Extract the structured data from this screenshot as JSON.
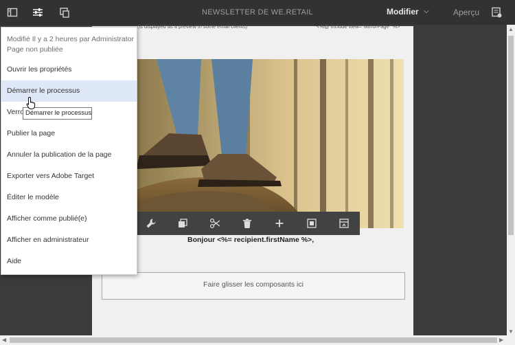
{
  "header": {
    "title": "NEWSLETTER DE WE.RETAIL",
    "mode": "Modifier",
    "preview": "Aperçu"
  },
  "canvas": {
    "preview_text": "(is displayed as a preview in some email clients)",
    "mirror_text": "<%@ include view=\"MirrorPage\" %>",
    "greeting_prefix": "Bonjour ",
    "greeting_var": "<%= recipient.firstName %>",
    "greeting_suffix": ",",
    "dropzone": "Faire glisser les composants ici"
  },
  "menu": {
    "modified": "Modifié Il y a 2 heures par Administrator",
    "status": "Page non publiée",
    "items": [
      {
        "label": "Ouvrir les propriétés"
      },
      {
        "label": "Démarrer le processus"
      },
      {
        "label": "Verro"
      },
      {
        "label": "Publier la page"
      },
      {
        "label": "Annuler la publication de la page"
      },
      {
        "label": "Exporter vers Adobe Target"
      },
      {
        "label": "Éditer le modèle"
      },
      {
        "label": "Afficher comme publié(e)"
      },
      {
        "label": "Afficher en administrateur"
      },
      {
        "label": "Aide"
      }
    ],
    "hovered_index": 1
  },
  "tooltip": "Démarrer le processus",
  "icons": {
    "sidebar_toggle": "sidebar-toggle-icon",
    "page_info": "sliders-icon",
    "emulator": "emulator-icon",
    "annotations": "annotations-icon",
    "configure": "wrench-icon",
    "copy": "copy-icon",
    "cut": "scissors-icon",
    "delete": "trash-icon",
    "insert": "plus-icon",
    "group": "group-icon",
    "parent": "parent-icon"
  },
  "colors": {
    "toolbar_bg": "#323232",
    "hover_bg": "#dfe8f6",
    "component_toolbar_bg": "#424242"
  }
}
